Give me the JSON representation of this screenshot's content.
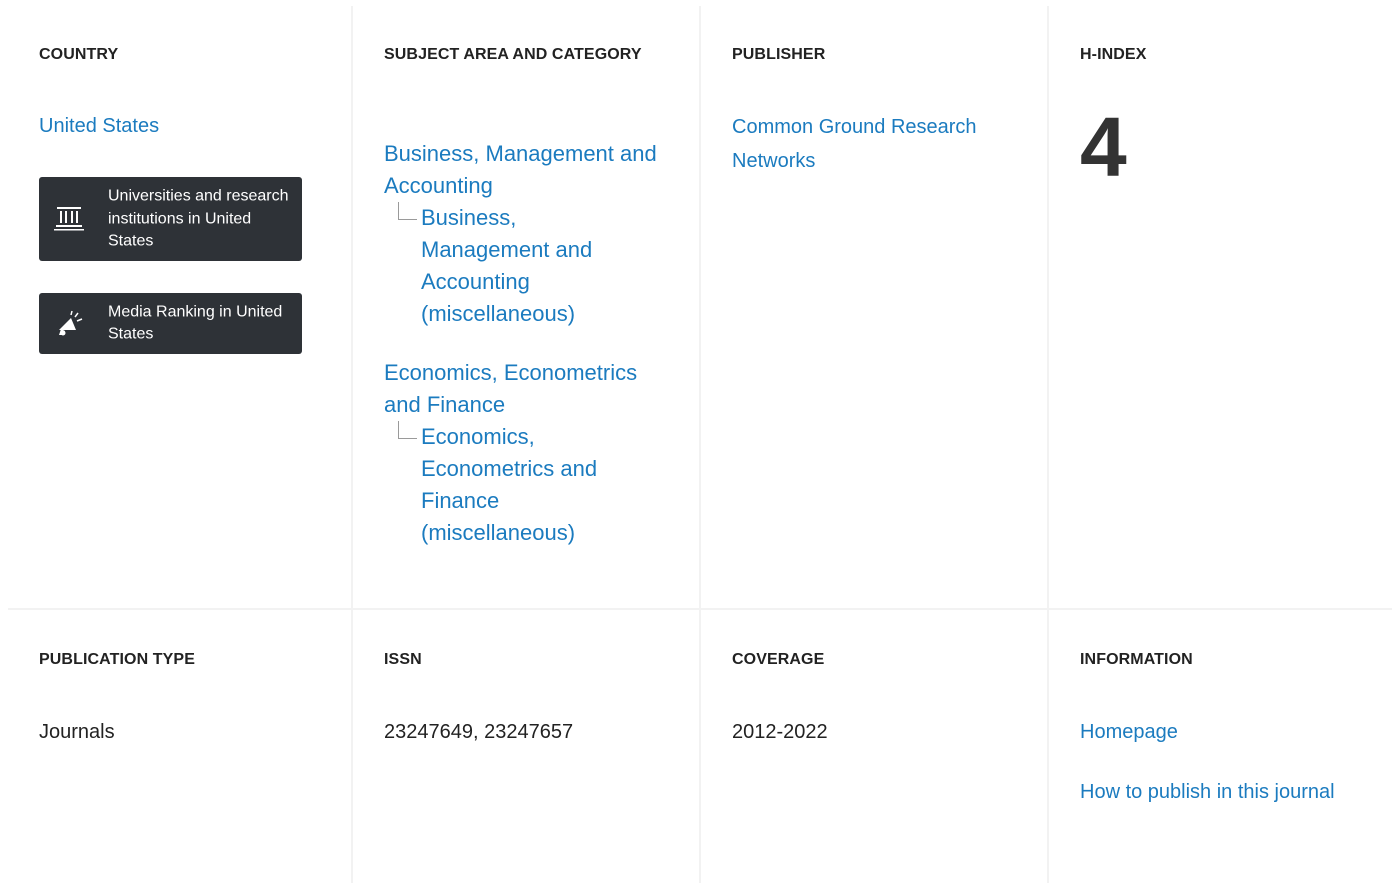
{
  "country": {
    "heading": "COUNTRY",
    "value": "United States",
    "universities_button": "Universities and research institutions in United States",
    "media_button": "Media Ranking in United States"
  },
  "subject": {
    "heading": "SUBJECT AREA AND CATEGORY",
    "areas": [
      {
        "area": "Business, Management and Accounting",
        "category": "Business, Management and Accounting (miscellaneous)"
      },
      {
        "area": "Economics, Econometrics and Finance",
        "category": "Economics, Econometrics and Finance (miscellaneous)"
      }
    ]
  },
  "publisher": {
    "heading": "PUBLISHER",
    "value": "Common Ground Research Networks"
  },
  "hindex": {
    "heading": "H-INDEX",
    "value": "4"
  },
  "publication_type": {
    "heading": "PUBLICATION TYPE",
    "value": "Journals"
  },
  "issn": {
    "heading": "ISSN",
    "value": "23247649, 23247657"
  },
  "coverage": {
    "heading": "COVERAGE",
    "value": "2012-2022"
  },
  "information": {
    "heading": "INFORMATION",
    "homepage": "Homepage",
    "how_to_publish": "How to publish in this journal"
  },
  "icons": {
    "universities": "institution-icon",
    "media": "megaphone-icon"
  },
  "colors": {
    "link": "#1b7bbf",
    "dark_button": "#2e3237",
    "divider": "#f2f2f2",
    "text": "#222222"
  }
}
